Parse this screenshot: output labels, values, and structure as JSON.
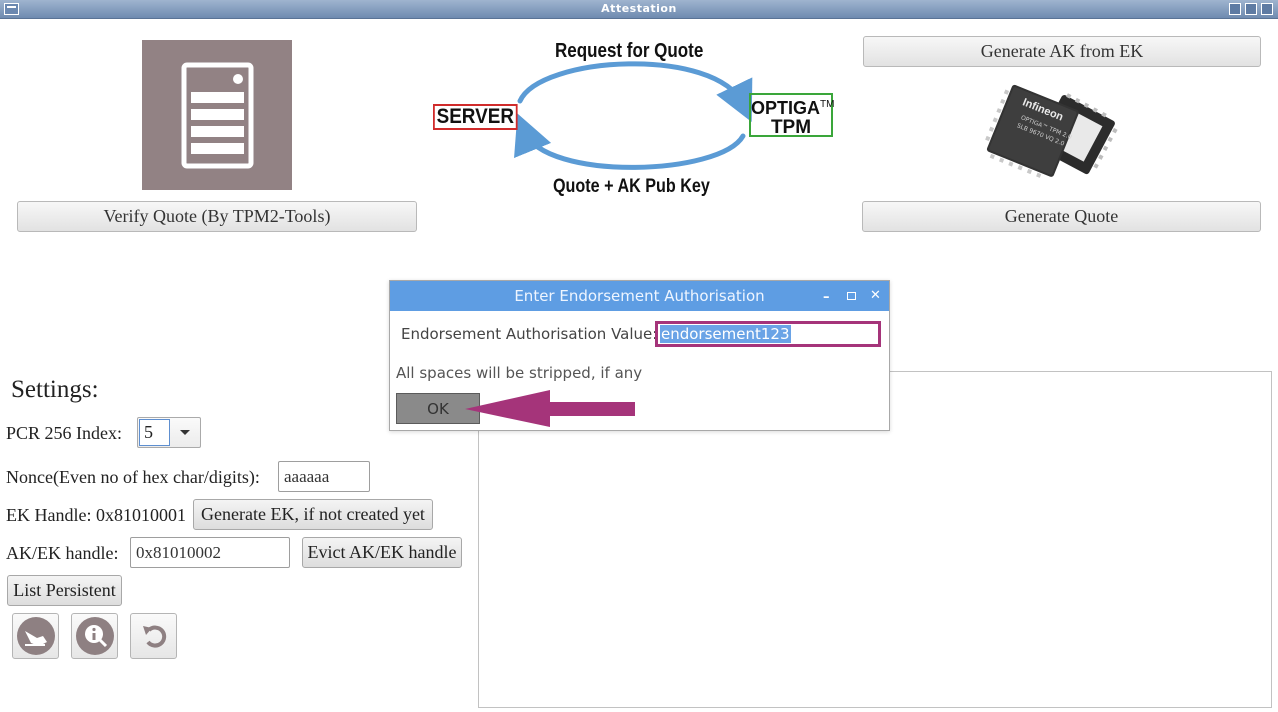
{
  "window": {
    "title": "Attestation"
  },
  "top": {
    "verify_button": "Verify Quote (By TPM2-Tools)",
    "generate_ak_button": "Generate AK from EK",
    "generate_quote_button": "Generate Quote"
  },
  "diagram": {
    "top_label": "Request for Quote",
    "bottom_label": "Quote + AK Pub Key",
    "server_label": "SERVER",
    "tpm_label_line1": "OPTIGA",
    "tpm_trademark": "TM",
    "tpm_label_line2": "TPM",
    "colors": {
      "server_border": "#d02b2b",
      "tpm_border": "#3aa63a",
      "arrow": "#5b9bd5"
    }
  },
  "chip": {
    "brand": "Infineon",
    "line1": "OPTIGA™ TPM 2.0",
    "line2": "SLB 9670 VQ 2.0"
  },
  "settings": {
    "heading": "Settings:",
    "pcr_label": "PCR 256 Index:",
    "pcr_value": "5",
    "nonce_label": "Nonce(Even no of hex char/digits):",
    "nonce_value": "aaaaaa",
    "ek_handle_label": "EK Handle: 0x81010001",
    "generate_ek_button": "Generate EK, if not created yet",
    "ak_handle_label": "AK/EK handle:",
    "ak_handle_value": "0x81010002",
    "evict_button": "Evict AK/EK handle",
    "list_persistent_button": "List Persistent"
  },
  "icons": [
    "swipe-icon",
    "info-icon",
    "refresh-icon"
  ],
  "dialog": {
    "title": "Enter Endorsement Authorisation",
    "field_label": "Endorsement Authorisation Value:",
    "field_value": "endorsement123",
    "hint": "All spaces will be stripped, if any",
    "ok_label": "OK",
    "annotation_color": "#a5347a"
  }
}
